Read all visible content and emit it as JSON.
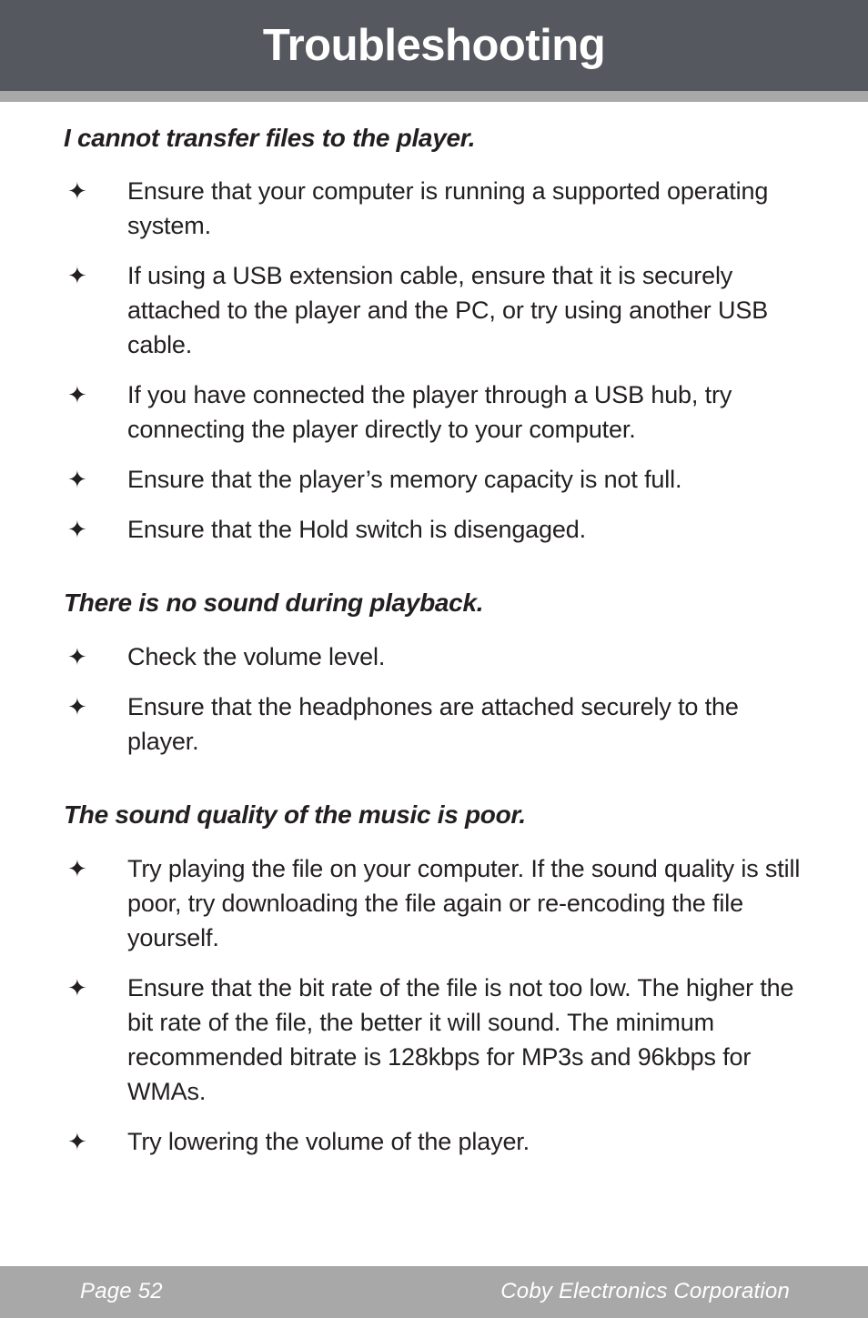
{
  "header": {
    "title": "Troubleshooting",
    "bar_color": "#55585e",
    "underbar_color": "#a8a8a8",
    "title_color": "#ffffff"
  },
  "bullet_glyph": "✦",
  "body_text_color": "#231f20",
  "sections": [
    {
      "heading": "I cannot transfer files to the player.",
      "bullets": [
        "Ensure that your computer is running a supported operating system.",
        "If using a USB extension cable, ensure that it is securely attached to the player and the PC, or try using another USB cable.",
        "If you have connected the player through a USB hub, try connecting the player directly to your computer.",
        "Ensure that the player’s memory capacity is not full.",
        "Ensure that the Hold switch is disengaged."
      ]
    },
    {
      "heading": "There is no sound during playback.",
      "bullets": [
        "Check the volume level.",
        "Ensure that the headphones are attached securely to the player."
      ]
    },
    {
      "heading": "The sound quality of the music is poor.",
      "bullets": [
        "Try playing the file on your computer. If the sound quality is still poor, try downloading the file again or re-encoding the file yourself.",
        "Ensure that the bit rate of the file is not too low. The higher the bit rate of the file, the better it will sound. The minimum recommended bitrate is 128kbps for MP3s and 96kbps for WMAs.",
        "Try lowering the volume of the player."
      ]
    }
  ],
  "footer": {
    "page_label": "Page 52",
    "company": "Coby Electronics Corporation",
    "bar_color": "#a8a8a8",
    "text_color": "#ffffff"
  }
}
